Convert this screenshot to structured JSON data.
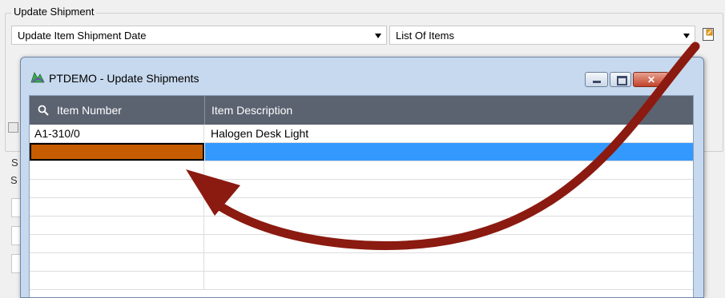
{
  "group": {
    "title": "Update Shipment",
    "action_select": "Update Item Shipment Date",
    "source_select": "List Of Items",
    "open_button_icon": "open-list-icon"
  },
  "background_form": {
    "partial_labels": [
      "S",
      "S"
    ]
  },
  "dialog": {
    "app_icon": "ptdemo-app-icon",
    "title": "PTDEMO - Update Shipments",
    "window_buttons": [
      "minimize-icon",
      "maximize-icon",
      "close-icon"
    ],
    "columns": [
      "Item Number",
      "Item Description"
    ],
    "rows": [
      {
        "item_number": "A1-310/0",
        "description": "Halogen Desk Light"
      },
      {
        "item_number": "",
        "description": ""
      }
    ],
    "empty_rows": 7
  },
  "annotation": {
    "arrow_color": "#8b1a10"
  },
  "colors": {
    "header_bg": "#5b6270",
    "selected_cell": "#c65c00",
    "selected_row": "#3399ff"
  }
}
